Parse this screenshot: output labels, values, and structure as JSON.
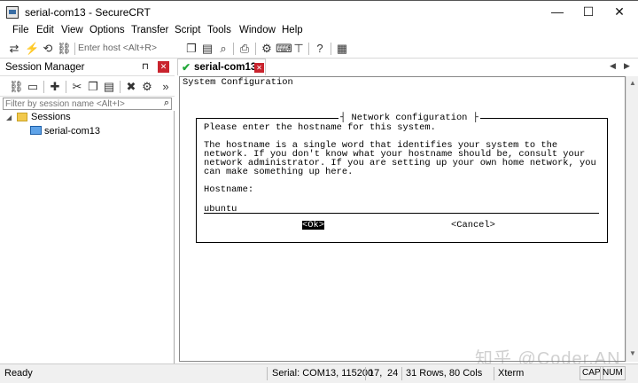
{
  "window": {
    "title": "serial-com13 - SecureCRT",
    "minimize": "—",
    "maximize": "☐",
    "close": "✕"
  },
  "menu": [
    "File",
    "Edit",
    "View",
    "Options",
    "Transfer",
    "Script",
    "Tools",
    "Window",
    "Help"
  ],
  "toolbar": {
    "enter_host_placeholder": "Enter host <Alt+R>"
  },
  "session_manager": {
    "title": "Session Manager",
    "pin": "⊓",
    "close": "✕",
    "filter_placeholder": "Filter by session name <Alt+I>",
    "tree": {
      "folder": "Sessions",
      "session": "serial-com13"
    }
  },
  "tab": {
    "check": "✔",
    "label": "serial-com13",
    "close": "✕"
  },
  "terminal": {
    "header": "System Configuration",
    "dialog_title": "┤ Network configuration ├",
    "prompt_line": "Please enter the hostname for this system.",
    "desc_lines": [
      "The hostname is a single word that identifies your system to the",
      "network. If you don't know what your hostname should be, consult your",
      "network administrator. If you are setting up your own home network, you",
      "can make something up here."
    ],
    "hostname_label": "Hostname:",
    "hostname_value": "ubuntu",
    "ok_button": "<Ok>",
    "cancel_button": "<Cancel>"
  },
  "statusbar": {
    "ready": "Ready",
    "connection": "Serial: COM13, 115200",
    "cursor_row": "17,",
    "cursor_col": "24",
    "size": "31 Rows, 80 Cols",
    "emulation": "Xterm",
    "cap": "CAP",
    "num": "NUM"
  },
  "watermark": "知乎 @Coder.AN"
}
